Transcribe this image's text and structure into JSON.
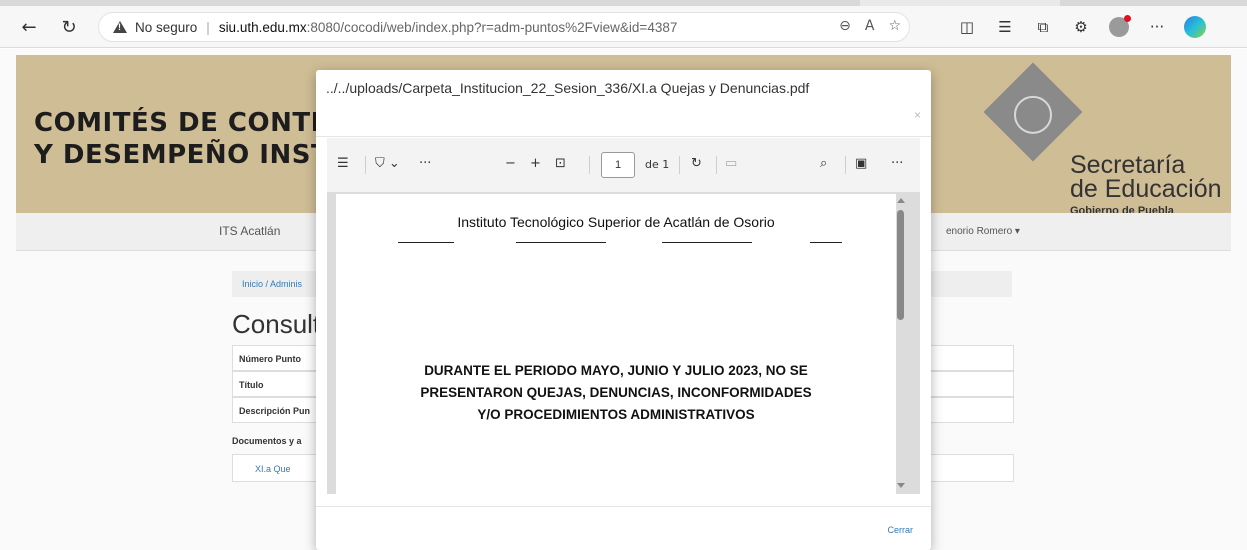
{
  "browser": {
    "back_icon": "←",
    "refresh_icon": "↻",
    "security_label": "No seguro",
    "url_host": "siu.uth.edu.mx",
    "url_path": ":8080/cocodi/web/index.php?r=adm-puntos%2Fview&id=4387",
    "addr_icons": [
      "zoom-icon",
      "read-aloud-icon",
      "favorite-icon"
    ],
    "more_icon": "···"
  },
  "page": {
    "banner_title_line1": "COMITÉS DE CONTROL",
    "banner_title_line2": "Y DESEMPEÑO INSTITU",
    "secretaria_line1": "Secretaría",
    "secretaria_line2": "de Educación",
    "gobierno": "Gobierno de Puebla",
    "nav_brand": "ITS Acatlán",
    "nav_user": "enorio Romero ▾",
    "breadcrumb": "Inicio  /  Adminis",
    "heading": "Consult",
    "rows": [
      "Número Punto",
      "Título",
      "Descripción Pun"
    ],
    "docs_label": "Documentos y a",
    "doc_link": "XI.a Que"
  },
  "modal": {
    "title": "../../uploads/Carpeta_Institucion_22_Sesion_336/XI.a Quejas y Denuncias.pdf",
    "close": "×",
    "footer_button": "Cerrar",
    "pdf": {
      "page_current": "1",
      "page_total": "de 1",
      "header": "Instituto Tecnológico Superior de Acatlán de Osorio",
      "body_line1": "DURANTE EL PERIODO MAYO, JUNIO Y JULIO 2023, NO SE",
      "body_line2": "PRESENTARON QUEJAS, DENUNCIAS, INCONFORMIDADES",
      "body_line3": "Y/O PROCEDIMIENTOS ADMINISTRATIVOS"
    }
  }
}
